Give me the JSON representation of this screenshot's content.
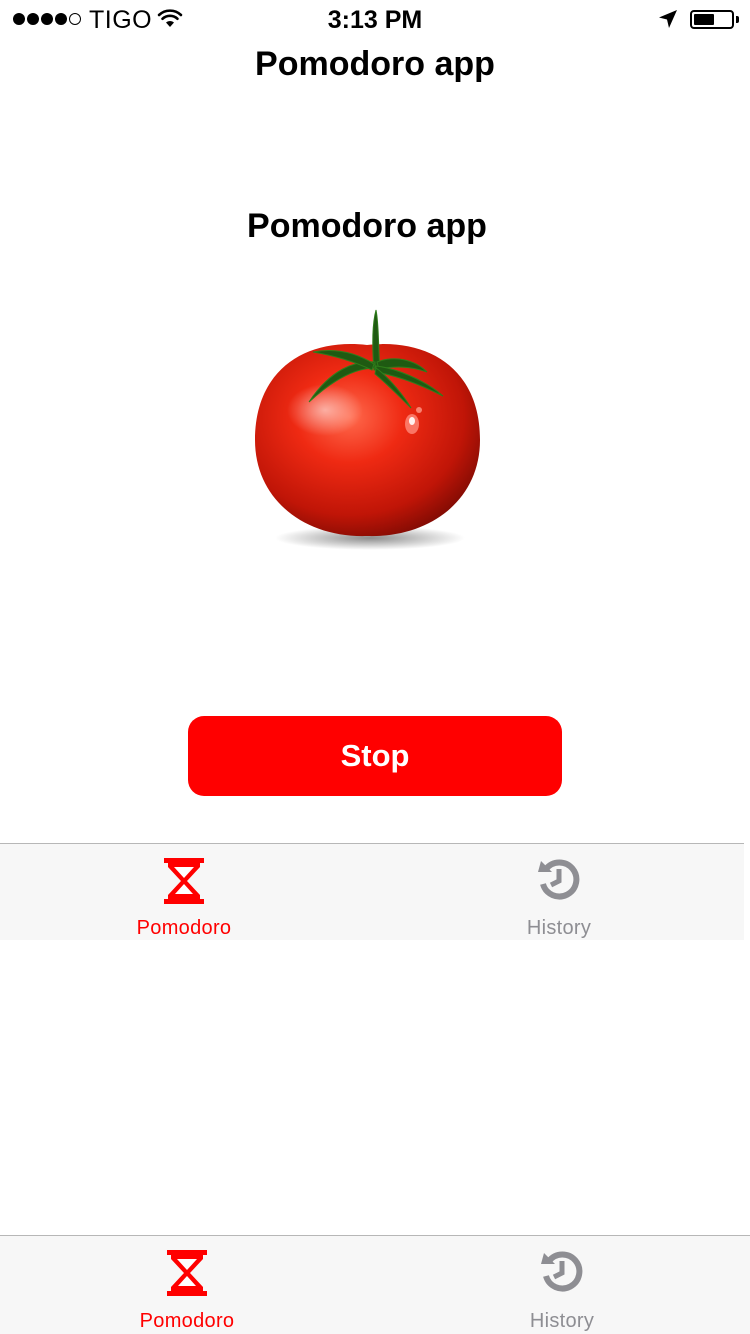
{
  "status_bar": {
    "carrier": "TIGO",
    "time": "3:13 PM",
    "signal_bars_filled": 4,
    "signal_bars_total": 5,
    "icons": [
      "wifi-icon",
      "location-arrow-icon",
      "battery-icon"
    ]
  },
  "nav": {
    "title": "Pomodoro app"
  },
  "main": {
    "heading": "Pomodoro app",
    "image": "tomato-illustration",
    "stop_label": "Stop"
  },
  "tabs": [
    {
      "label": "Pomodoro",
      "icon": "hourglass-icon",
      "active": true
    },
    {
      "label": "History",
      "icon": "history-clock-icon",
      "active": false
    }
  ],
  "colors": {
    "accent": "#ff0000",
    "tab_inactive": "#8e8e93",
    "tab_bar_bg": "#f7f7f7",
    "background": "#ffffff"
  }
}
